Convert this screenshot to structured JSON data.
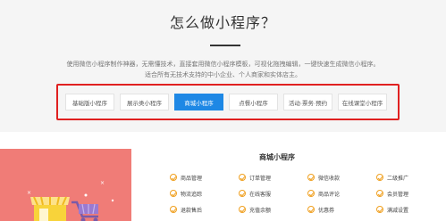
{
  "header": {
    "title": "怎么做小程序？",
    "desc_line1": "使用微信小程序制作神器，无需懂技术，直接套用微信小程序模板，可视化拖拽编辑，一键快速生成微信小程序。",
    "desc_line2": "适合所有无技术支持的中小企业、个人商家和实体店主。"
  },
  "tabs": [
    {
      "label": "基础版小程序",
      "active": false
    },
    {
      "label": "展示类小程序",
      "active": false
    },
    {
      "label": "商城小程序",
      "active": true
    },
    {
      "label": "点餐小程序",
      "active": false
    },
    {
      "label": "活动·票务·预约",
      "active": false
    },
    {
      "label": "在线课堂小程序",
      "active": false
    }
  ],
  "panel": {
    "title": "商城小程序",
    "features": [
      [
        "商品管理",
        "订单管理",
        "微信收款",
        "二级推广"
      ],
      [
        "物流追踪",
        "在线客服",
        "商品评论",
        "会员管理"
      ],
      [
        "退款售后",
        "充值余额",
        "优惠券",
        "满减设置"
      ]
    ]
  },
  "colors": {
    "accent_blue": "#1e88e5",
    "highlight_red": "#e02020",
    "check_orange": "#f0a020",
    "illustration_bg": "#f07c77"
  }
}
